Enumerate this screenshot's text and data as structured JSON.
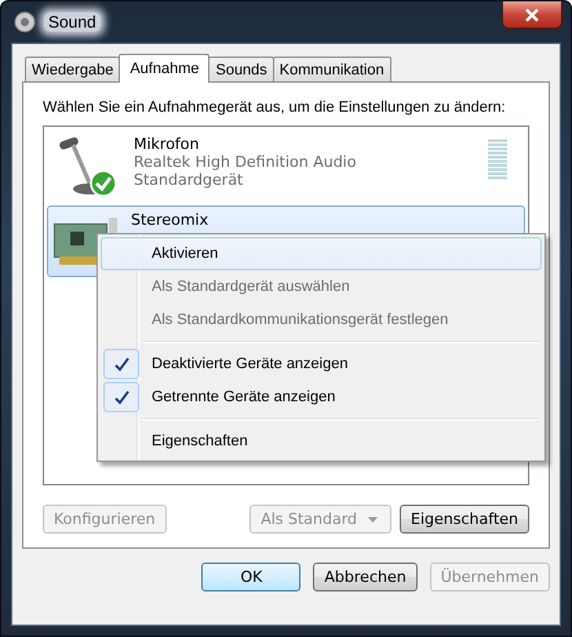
{
  "window": {
    "title": "Sound"
  },
  "tabs": [
    {
      "label": "Wiedergabe",
      "selected": false
    },
    {
      "label": "Aufnahme",
      "selected": true
    },
    {
      "label": "Sounds",
      "selected": false
    },
    {
      "label": "Kommunikation",
      "selected": false
    }
  ],
  "instruction": "Wählen Sie ein Aufnahmegerät aus, um die Einstellungen zu ändern:",
  "devices": [
    {
      "kind": "microphone",
      "name": "Mikrofon",
      "lines": [
        "Realtek High Definition Audio",
        "Standardgerät"
      ],
      "default": true,
      "selected": false
    },
    {
      "kind": "soundcard",
      "name": "Stereomix",
      "selected": true
    }
  ],
  "context_menu": [
    {
      "kind": "item",
      "label": "Aktivieren",
      "disabled": false,
      "checked": false,
      "selected": true
    },
    {
      "kind": "item",
      "label": "Als Standardgerät auswählen",
      "disabled": true,
      "checked": false,
      "selected": false
    },
    {
      "kind": "item",
      "label": "Als Standardkommunikationsgerät festlegen",
      "disabled": true,
      "checked": false,
      "selected": false
    },
    {
      "kind": "separator"
    },
    {
      "kind": "item",
      "label": "Deaktivierte Geräte anzeigen",
      "disabled": false,
      "checked": true,
      "selected": false
    },
    {
      "kind": "item",
      "label": "Getrennte Geräte anzeigen",
      "disabled": false,
      "checked": true,
      "selected": false
    },
    {
      "kind": "separator"
    },
    {
      "kind": "item",
      "label": "Eigenschaften",
      "disabled": false,
      "checked": false,
      "selected": false
    }
  ],
  "panel_buttons": [
    {
      "kind": "button",
      "label": "Konfigurieren",
      "disabled": true
    },
    {
      "kind": "split",
      "label": "Als Standard",
      "disabled": true
    },
    {
      "kind": "button",
      "label": "Eigenschaften",
      "disabled": false
    }
  ],
  "dialog_buttons": [
    {
      "label": "OK",
      "disabled": false,
      "default": true
    },
    {
      "label": "Abbrechen",
      "disabled": false,
      "default": false
    },
    {
      "label": "Übernehmen",
      "disabled": true,
      "default": false
    }
  ]
}
